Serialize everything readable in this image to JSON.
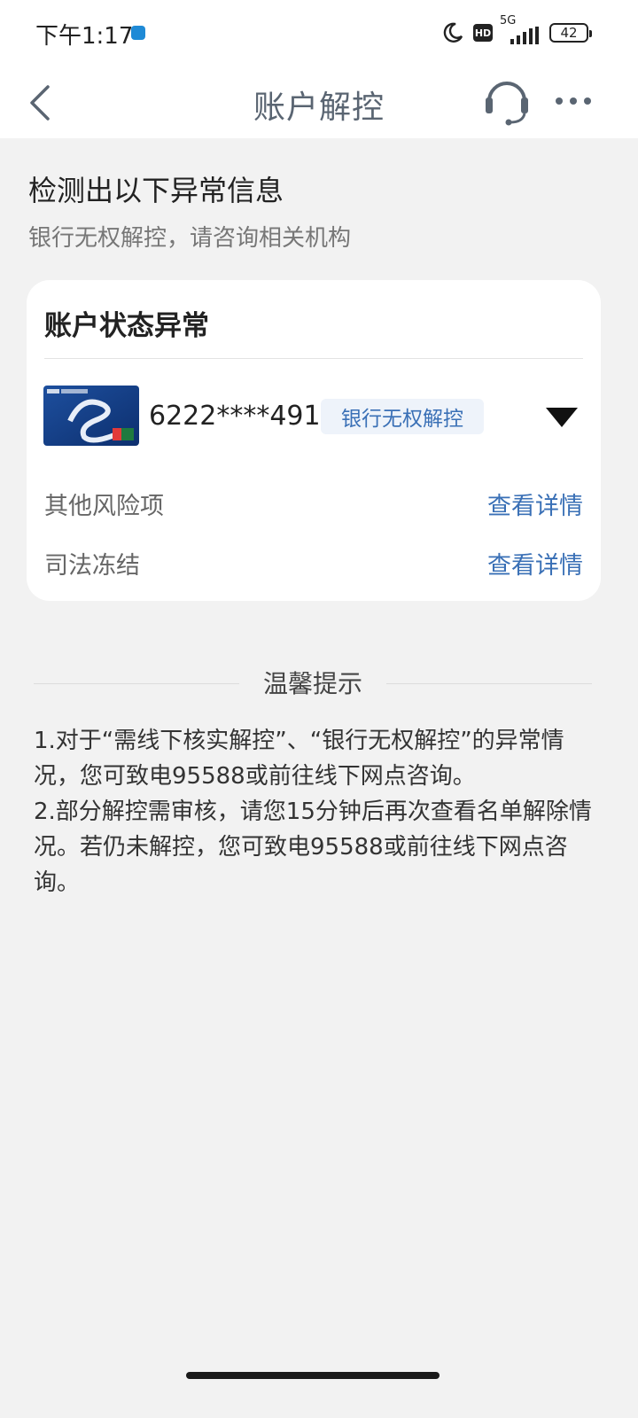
{
  "status_bar": {
    "time": "下午1:17",
    "hd_label": "HD",
    "network_label": "5G",
    "battery_level": "42"
  },
  "nav": {
    "title": "账户解控",
    "icons": [
      "back-icon",
      "headset-icon",
      "more-icon"
    ]
  },
  "intro": {
    "heading": "检测出以下异常信息",
    "subheading": "银行无权解控，请咨询相关机构"
  },
  "account_card": {
    "title": "账户状态异常",
    "card_number": "6222****4910",
    "status_tag": "银行无权解控",
    "bank_card_logo_text": "ICBC 中国工商银行",
    "rows": [
      {
        "label": "其他风险项",
        "link": "查看详情"
      },
      {
        "label": "司法冻结",
        "link": "查看详情"
      }
    ]
  },
  "tips": {
    "heading": "温馨提示",
    "lines": [
      "1.对于“需线下核实解控”、“银行无权解控”的异常情况，您可致电95588或前往线下网点咨询。",
      "2.部分解控需审核，请您15分钟后再次查看名单解除情况。若仍未解控，您可致电95588或前往线下网点咨询。"
    ]
  },
  "colors": {
    "accent": "#3a70b6",
    "background": "#f2f2f2",
    "title_gray": "#5a6572"
  }
}
